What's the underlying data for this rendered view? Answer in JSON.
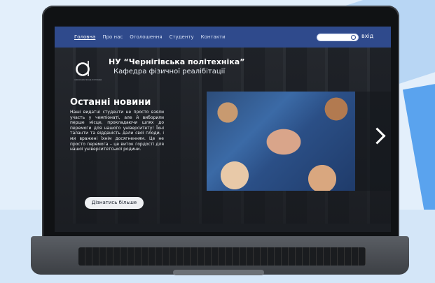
{
  "nav": {
    "items": [
      "Головна",
      "Про нас",
      "Оголошення",
      "Студенту",
      "Контакти"
    ],
    "active_index": 0,
    "login_label": "вхід"
  },
  "header": {
    "university": "НУ “Чернігівська політехніка”",
    "department": "Кафедра фізичної реалібітації",
    "logo_caption": "ОСВІТНЯ ЧЕРНІГІВСЬКА ПОЛІТЕХНІКА"
  },
  "news": {
    "title": "Останні новини",
    "text": "Наші видатні студенти не просто взяли участь у чемпіонаті, але й виборили перше місце, прокладаючи шлях до перемоги для нашого університету! Їхні таланти та відданість дали свої плоди, і ми вражені їхнім досягненням. Це не просто перемога – це виток гордості для нашої університетської родини.",
    "more_button": "Дізнатись більше"
  },
  "colors": {
    "nav_bg": "#2f4a8c",
    "page_bg": "#e3effb"
  },
  "icons": {
    "next": "chevron-right-icon",
    "search": "search-icon"
  }
}
